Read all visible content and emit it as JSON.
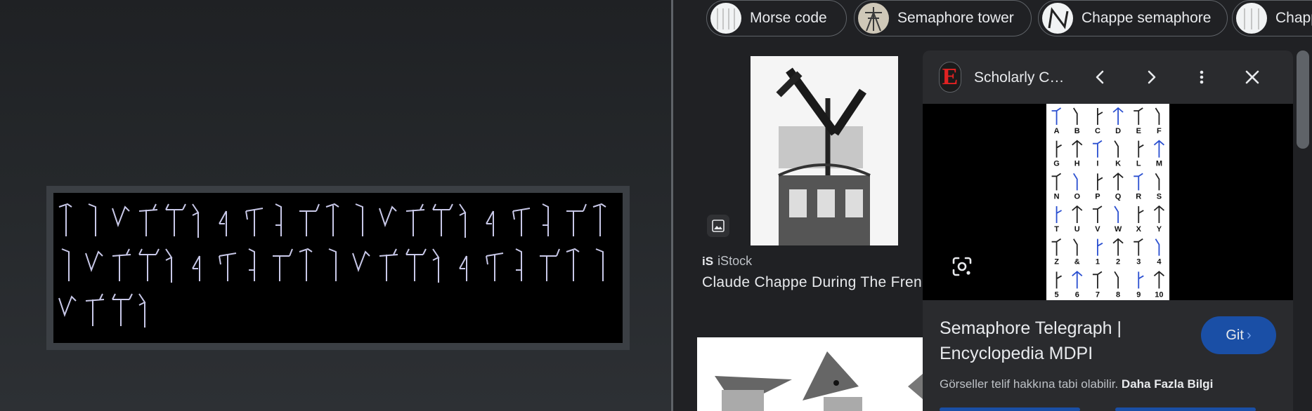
{
  "chips": [
    {
      "label": "Morse code"
    },
    {
      "label": "Semaphore tower"
    },
    {
      "label": "Chappe semaphore"
    },
    {
      "label": "Chapp"
    }
  ],
  "result": {
    "source": "iStock",
    "source_logo": "iS",
    "title": "Claude Chappe During The Fren"
  },
  "panel": {
    "site_logo": "E",
    "site_name": "Scholarly C…",
    "title": "Semaphore Telegraph | Encyclopedia MDPI",
    "visit_label": "Git",
    "visit_chevron": "›",
    "copyright": "Görseller telif hakkına tabi olabilir.",
    "learn_more": "Daha Fazla Bilgi",
    "alphabet_rows": [
      [
        "A",
        "B",
        "C",
        "D",
        "E",
        "F"
      ],
      [
        "G",
        "H",
        "I",
        "K",
        "L",
        "M"
      ],
      [
        "N",
        "O",
        "P",
        "Q",
        "R",
        "S"
      ],
      [
        "T",
        "U",
        "V",
        "W",
        "X",
        "Y"
      ],
      [
        "Z",
        "&",
        "1",
        "2",
        "3",
        "4"
      ],
      [
        "5",
        "6",
        "7",
        "8",
        "9",
        "10"
      ]
    ]
  },
  "icons": {
    "chip_thumb": "thumbnail",
    "image_type": "image-icon",
    "prev": "chevron-left-icon",
    "next": "chevron-right-icon",
    "more": "more-vert-icon",
    "close": "close-icon",
    "lens": "lens-icon"
  },
  "colors": {
    "background": "#202124",
    "visit_button": "#1a4fa6",
    "site_logo_red": "#e02222"
  }
}
